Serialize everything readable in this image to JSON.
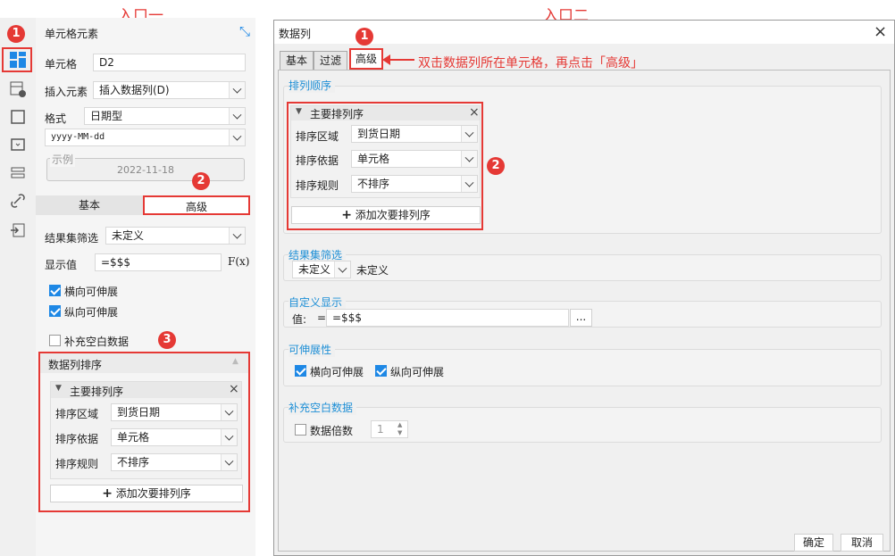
{
  "labels": {
    "entry_one": "入口一",
    "entry_two": "入口二",
    "instruction": "双击数据列所在单元格，再点击「高级」"
  },
  "badges": [
    "1",
    "2",
    "3"
  ],
  "left_panel": {
    "title": "单元格元素",
    "cell_label": "单元格",
    "cell_value": "D2",
    "insert_label": "插入元素",
    "insert_value": "插入数据列(D)",
    "format_label": "格式",
    "format_value": "日期型",
    "pattern_value": "yyyy-MM-dd",
    "example_label": "示例",
    "example_value": "2022-11-18",
    "tab_basic": "基本",
    "tab_advanced": "高级",
    "filter_label": "结果集筛选",
    "filter_value": "未定义",
    "display_label": "显示值",
    "display_value": "=$$$",
    "fx": "F(x)",
    "horiz_expand": "横向可伸展",
    "vert_expand": "纵向可伸展",
    "fill_blank": "补充空白数据",
    "sort_section": "数据列排序",
    "primary_sort": "主要排列序",
    "sort_area_label": "排序区域",
    "sort_area_value": "到货日期",
    "sort_by_label": "排序依据",
    "sort_by_value": "单元格",
    "sort_rule_label": "排序规则",
    "sort_rule_value": "不排序",
    "add_secondary": "添加次要排列序"
  },
  "dialog": {
    "title": "数据列",
    "tabs": [
      "基本",
      "过滤",
      "高级"
    ],
    "sort_group": "排列顺序",
    "primary_sort": "主要排列序",
    "sort_area_label": "排序区域",
    "sort_area_value": "到货日期",
    "sort_by_label": "排序依据",
    "sort_by_value": "单元格",
    "sort_rule_label": "排序规则",
    "sort_rule_value": "不排序",
    "add_secondary": "添加次要排列序",
    "filter_group": "结果集筛选",
    "filter_value": "未定义",
    "filter_text": "未定义",
    "custom_group": "自定义显示",
    "value_label": "值:",
    "value_eq": "=",
    "value_value": "=$$$",
    "ellipsis": "...",
    "expand_group": "可伸展性",
    "horiz_expand": "横向可伸展",
    "vert_expand": "纵向可伸展",
    "fill_group": "补充空白数据",
    "multiple_label": "数据倍数",
    "multiple_value": "1",
    "ok": "确定",
    "cancel": "取消"
  }
}
